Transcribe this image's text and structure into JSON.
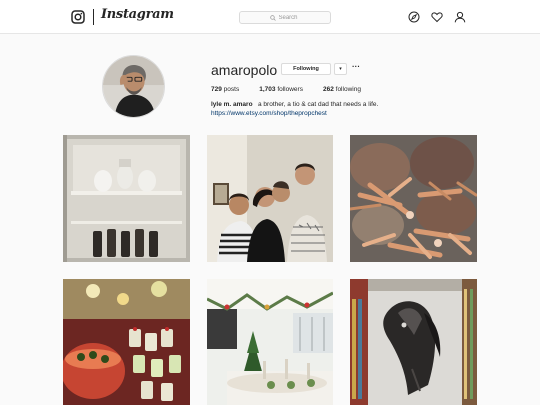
{
  "header": {
    "wordmark": "Instagram",
    "search_placeholder": "Search"
  },
  "profile": {
    "username": "amaropolo",
    "following_button": "Following",
    "dropdown_glyph": "▾",
    "more_glyph": "···",
    "posts_count": "729",
    "posts_label": "posts",
    "followers_count": "1,703",
    "followers_label": "followers",
    "following_count": "262",
    "following_label": "following",
    "full_name": "lyle m. amaro",
    "bio": "a brother, a tio & cat dad that needs a life.",
    "website": "https://www.etsy.com/shop/thepropchest"
  },
  "posts": [
    {
      "subject": "refrigerator-with-bottles"
    },
    {
      "subject": "group-selfie"
    },
    {
      "subject": "crabs"
    },
    {
      "subject": "party-drinks"
    },
    {
      "subject": "holiday-dinner-table"
    },
    {
      "subject": "horse-drawing"
    }
  ],
  "colors": {
    "background": "#fafafa",
    "link": "#003569",
    "border": "#dbdbdb"
  }
}
